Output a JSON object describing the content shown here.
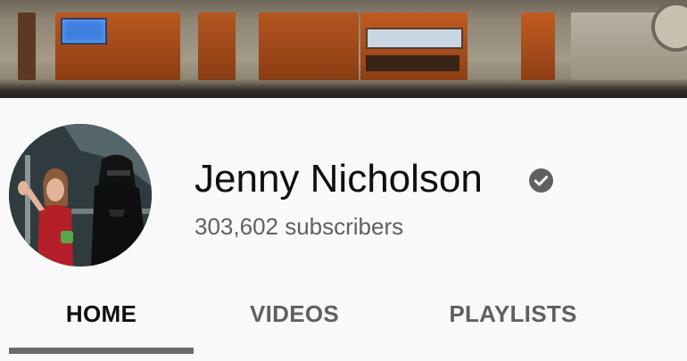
{
  "channel": {
    "name": "Jenny Nicholson",
    "subscribers": "303,602 subscribers",
    "verified": true
  },
  "tabs": [
    {
      "label": "HOME",
      "active": true
    },
    {
      "label": "VIDEOS",
      "active": false
    },
    {
      "label": "PLAYLISTS",
      "active": false
    }
  ],
  "colors": {
    "background": "#f9f9f9",
    "name_text": "#0f0f0f",
    "secondary_text": "#606060",
    "active_tab_underline": "#6a6a6a"
  }
}
